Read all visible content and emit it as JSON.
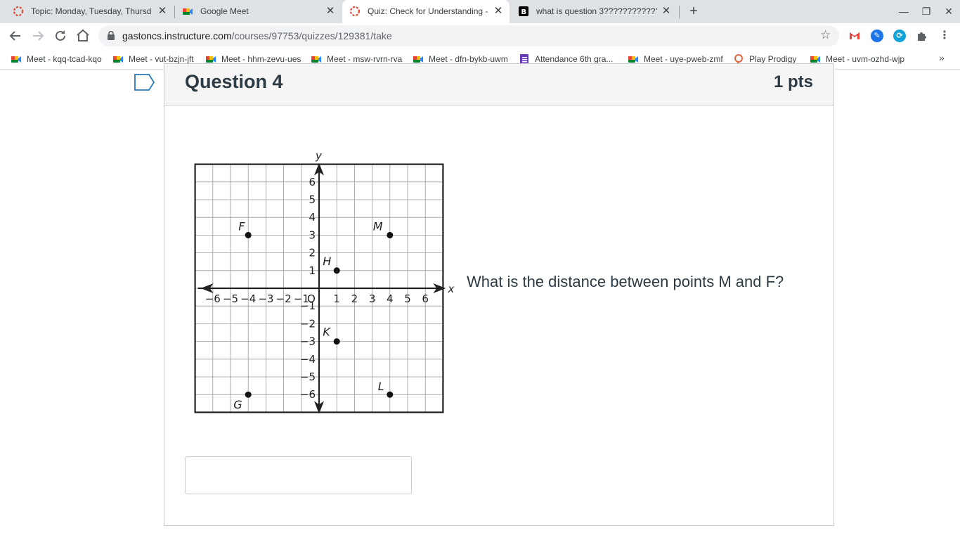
{
  "tabs": [
    {
      "title": "Topic: Monday, Tuesday, Thursd",
      "favicon": "canvas-icon",
      "active": false
    },
    {
      "title": "Google Meet",
      "favicon": "meet-icon",
      "active": false
    },
    {
      "title": "Quiz: Check for Understanding -",
      "favicon": "canvas-icon",
      "active": true
    },
    {
      "title": "what is question 3???????????? -",
      "favicon": "brainly-icon",
      "active": false
    }
  ],
  "toolbar": {
    "url_host": "gastoncs.instructure.com",
    "url_path": "/courses/97753/quizzes/129381/take"
  },
  "bookmarks": [
    {
      "label": "Meet - kqq-tcad-kqo",
      "icon": "meet-icon"
    },
    {
      "label": "Meet - vut-bzjn-jft",
      "icon": "meet-icon"
    },
    {
      "label": "Meet - hhm-zevu-ues",
      "icon": "meet-icon"
    },
    {
      "label": "Meet - msw-rvrn-rva",
      "icon": "meet-icon"
    },
    {
      "label": "Meet - dfn-bykb-uwm",
      "icon": "meet-icon"
    },
    {
      "label": "Attendance 6th gra...",
      "icon": "forms-icon"
    },
    {
      "label": "Meet - uye-pweb-zmf",
      "icon": "meet-icon"
    },
    {
      "label": "Play Prodigy",
      "icon": "prodigy-icon"
    },
    {
      "label": "Meet - uvm-ozhd-wjp",
      "icon": "meet-icon"
    }
  ],
  "question": {
    "title": "Question 4",
    "points": "1 pts",
    "text": "What is the distance between points M and F?",
    "answer_value": ""
  },
  "chart_data": {
    "type": "scatter",
    "xlabel": "x",
    "ylabel": "y",
    "xlim": [
      -7,
      7
    ],
    "ylim": [
      -7,
      7
    ],
    "grid": true,
    "origin_label": "O",
    "x_ticks": [
      "−6",
      "−5",
      "−4",
      "−3",
      "−2",
      "−1",
      "1",
      "2",
      "3",
      "4",
      "5",
      "6"
    ],
    "y_ticks": [
      "6",
      "5",
      "4",
      "3",
      "2",
      "1",
      "−1",
      "−2",
      "−3",
      "−4",
      "−5",
      "−6"
    ],
    "points": [
      {
        "label": "F",
        "x": -4,
        "y": 3
      },
      {
        "label": "M",
        "x": 4,
        "y": 3
      },
      {
        "label": "H",
        "x": 1,
        "y": 1
      },
      {
        "label": "K",
        "x": 1,
        "y": -3
      },
      {
        "label": "G",
        "x": -4,
        "y": -6
      },
      {
        "label": "L",
        "x": 4,
        "y": -6
      }
    ]
  }
}
